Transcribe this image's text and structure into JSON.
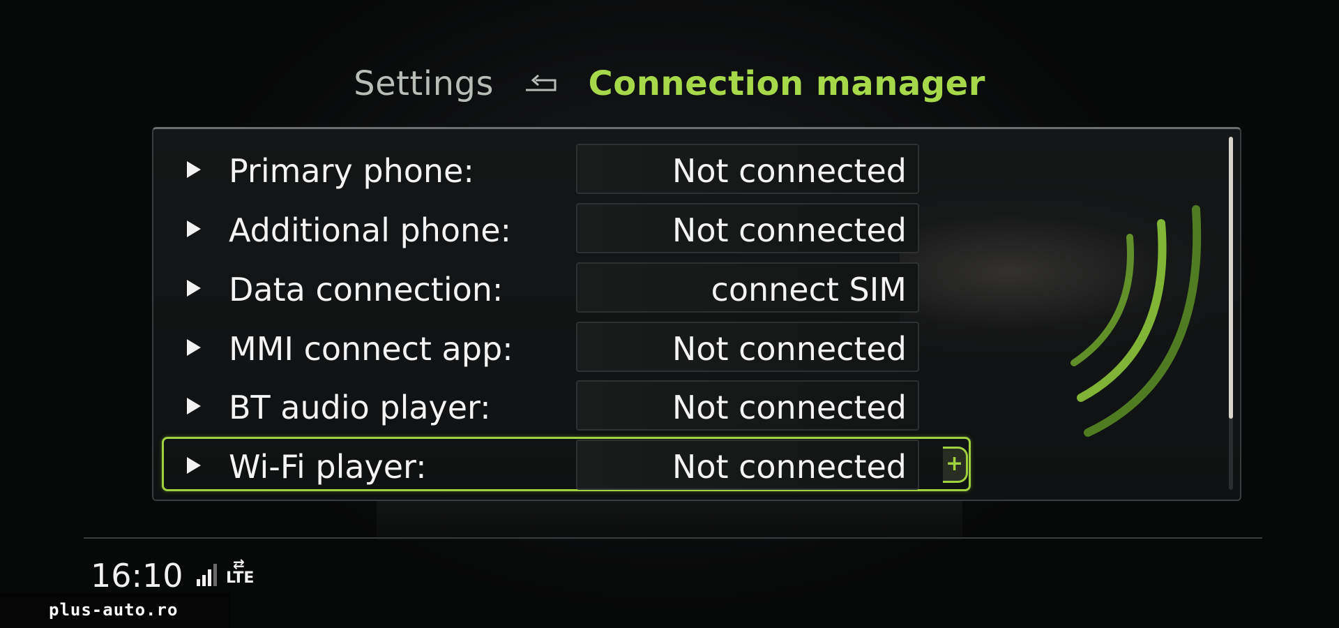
{
  "header": {
    "parent": "Settings",
    "current": "Connection manager",
    "back_icon": "return-arrow-icon"
  },
  "rows": [
    {
      "label": "Primary phone:",
      "value": "Not connected"
    },
    {
      "label": "Additional phone:",
      "value": "Not connected"
    },
    {
      "label": "Data connection:",
      "value": "connect SIM"
    },
    {
      "label": "MMI connect app:",
      "value": "Not connected"
    },
    {
      "label": "BT audio player:",
      "value": "Not connected"
    },
    {
      "label": "Wi-Fi player:",
      "value": "Not connected",
      "selected": true
    }
  ],
  "selection_tab_glyph": "+",
  "status": {
    "time": "16:10",
    "network": "LTE",
    "signal_icon": "cellular-signal-icon"
  },
  "watermark": "plus-auto.ro",
  "colors": {
    "accent": "#a6d94a",
    "text": "#f4f4f4",
    "muted": "#b9bdb8"
  }
}
